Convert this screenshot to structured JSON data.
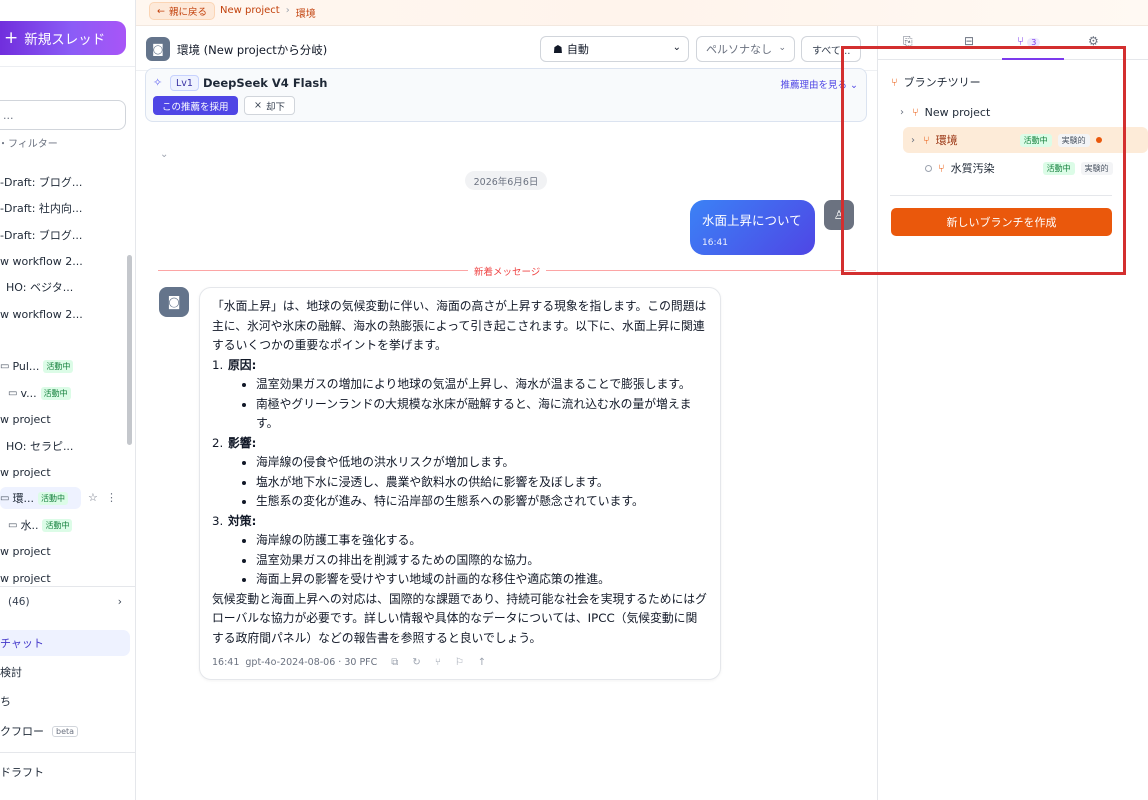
{
  "sidebar": {
    "new_thread": "新規スレッド",
    "search_placeholder": "...",
    "filter_label": "・フィルター",
    "items": [
      {
        "label": "-Draft: ブログ..."
      },
      {
        "label": "-Draft: 社内向..."
      },
      {
        "label": "-Draft: ブログ..."
      },
      {
        "label": "w workflow 2..."
      },
      {
        "label": "HO: ベジタ..."
      },
      {
        "label": "w workflow 2..."
      },
      {
        "label": "Pul...",
        "badge": "活動中"
      },
      {
        "label": "v...",
        "badge": "活動中"
      },
      {
        "label": "w project"
      },
      {
        "label": "HO: セラピ..."
      },
      {
        "label": "w project"
      },
      {
        "label": "環...",
        "badge": "活動中"
      },
      {
        "label": "水..",
        "badge": "活動中"
      },
      {
        "label": "w project"
      },
      {
        "label": "w project"
      }
    ],
    "count": "(46)",
    "nav": {
      "chat": "チャット",
      "review": "検討",
      "other": "ち",
      "workflow": "クフロー",
      "beta": "beta",
      "draft": "ドラフト"
    }
  },
  "topbar": {
    "back": "親に戻る",
    "crumbs": [
      "New project",
      "環境"
    ]
  },
  "header": {
    "title": "環境 (New projectから分岐)",
    "model": "自動",
    "persona": "ペルソナなし",
    "all": "すべて..."
  },
  "recommendation": {
    "level": "Lv1",
    "model": "DeepSeek V4 Flash",
    "why": "推薦理由を見る",
    "adopt": "この推薦を採用",
    "reject": "却下"
  },
  "chat": {
    "date": "2026年6月6日",
    "user_message": {
      "text": "水面上昇について",
      "time": "16:41"
    },
    "new_messages": "新着メッセージ",
    "assistant": {
      "intro": "「水面上昇」は、地球の気候変動に伴い、海面の高さが上昇する現象を指します。この問題は主に、氷河や氷床の融解、海水の熱膨張によって引き起こされます。以下に、水面上昇に関連するいくつかの重要なポイントを挙げます。",
      "sections": [
        {
          "num": "1.",
          "title": "原因",
          "bullets": [
            "温室効果ガスの増加により地球の気温が上昇し、海水が温まることで膨張します。",
            "南極やグリーンランドの大規模な氷床が融解すると、海に流れ込む水の量が増えます。"
          ]
        },
        {
          "num": "2.",
          "title": "影響",
          "bullets": [
            "海岸線の侵食や低地の洪水リスクが増加します。",
            "塩水が地下水に浸透し、農業や飲料水の供給に影響を及ぼします。",
            "生態系の変化が進み、特に沿岸部の生態系への影響が懸念されています。"
          ]
        },
        {
          "num": "3.",
          "title": "対策",
          "bullets": [
            "海岸線の防護工事を強化する。",
            "温室効果ガスの排出を削減するための国際的な協力。",
            "海面上昇の影響を受けやすい地域の計画的な移住や適応策の推進。"
          ]
        }
      ],
      "conclusion": "気候変動と海面上昇への対応は、国際的な課題であり、持続可能な社会を実現するためにはグローバルな協力が必要です。詳しい情報や具体的なデータについては、IPCC（気候変動に関する政府間パネル）などの報告書を参照すると良いでしょう。",
      "time": "16:41",
      "meta": "gpt-4o-2024-08-06 · 30 PFC"
    }
  },
  "right_panel": {
    "tab_count": "3",
    "tree_title": "ブランチツリー",
    "nodes": [
      {
        "label": "New project"
      },
      {
        "label": "環境",
        "status": "活動中",
        "tag": "実験的"
      },
      {
        "label": "水質汚染",
        "status": "活動中",
        "tag": "実験的"
      }
    ],
    "create_button": "新しいブランチを作成"
  },
  "colors": {
    "accent": "#ea580c",
    "primary": "#4f46e5",
    "highlight": "#d32f2f"
  }
}
